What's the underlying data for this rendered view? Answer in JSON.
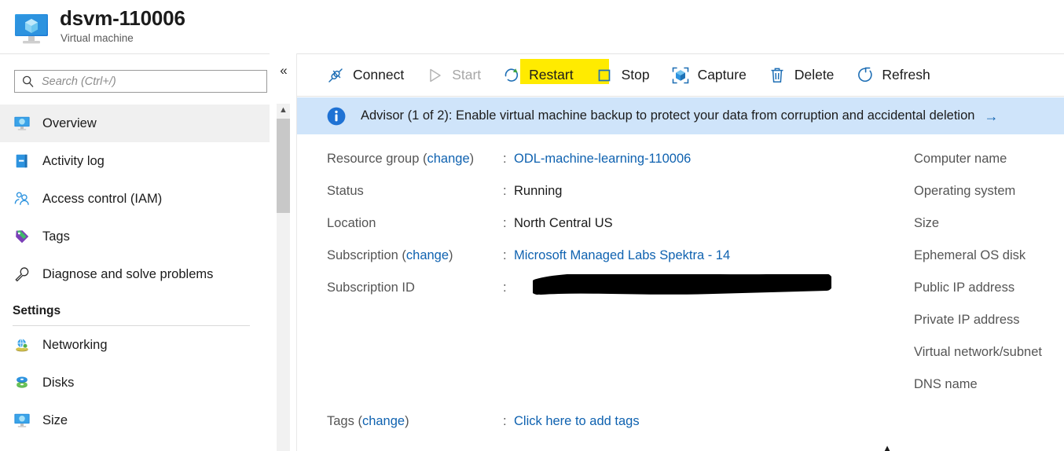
{
  "header": {
    "title": "dsvm-110006",
    "subtitle": "Virtual machine",
    "icon": "virtual-machine-icon"
  },
  "sidebar": {
    "search": {
      "placeholder": "Search (Ctrl+/)",
      "value": "",
      "icon": "search-icon"
    },
    "collapse_icon": "chevron-double-left-icon",
    "items": [
      {
        "label": "Overview",
        "icon": "monitor-icon",
        "selected": true
      },
      {
        "label": "Activity log",
        "icon": "book-icon",
        "selected": false
      },
      {
        "label": "Access control (IAM)",
        "icon": "people-icon",
        "selected": false
      },
      {
        "label": "Tags",
        "icon": "tag-icon",
        "selected": false
      },
      {
        "label": "Diagnose and solve problems",
        "icon": "wrench-icon",
        "selected": false
      }
    ],
    "group": {
      "title": "Settings",
      "items": [
        {
          "label": "Networking",
          "icon": "network-globe-icon",
          "selected": false
        },
        {
          "label": "Disks",
          "icon": "disks-icon",
          "selected": false
        },
        {
          "label": "Size",
          "icon": "monitor-icon",
          "selected": false
        }
      ]
    },
    "scrollbar": {
      "up_icon": "chevron-up-icon"
    }
  },
  "toolbar": {
    "buttons": [
      {
        "label": "Connect",
        "icon": "plug-icon",
        "enabled": true,
        "highlighted": false
      },
      {
        "label": "Start",
        "icon": "play-icon",
        "enabled": false,
        "highlighted": false
      },
      {
        "label": "Restart",
        "icon": "restart-arrow-icon",
        "enabled": true,
        "highlighted": true
      },
      {
        "label": "Stop",
        "icon": "stop-square-icon",
        "enabled": true,
        "highlighted": false
      },
      {
        "label": "Capture",
        "icon": "capture-cube-icon",
        "enabled": true,
        "highlighted": false
      },
      {
        "label": "Delete",
        "icon": "trash-icon",
        "enabled": true,
        "highlighted": false
      },
      {
        "label": "Refresh",
        "icon": "refresh-circle-icon",
        "enabled": true,
        "highlighted": false
      }
    ],
    "highlight_color": "#ffeb00"
  },
  "banner": {
    "icon": "info-icon",
    "text": "Advisor (1 of 2): Enable virtual machine backup to protect your data from corruption and accidental deletion",
    "arrow": "→",
    "background": "#cfe4fa"
  },
  "properties_left": [
    {
      "label": "Resource group",
      "label_link": "change",
      "separator": ":",
      "value": "ODL-machine-learning-110006",
      "value_is_link": true,
      "redacted": false
    },
    {
      "label": "Status",
      "label_link": "",
      "separator": ":",
      "value": "Running",
      "value_is_link": false,
      "redacted": false
    },
    {
      "label": "Location",
      "label_link": "",
      "separator": ":",
      "value": "North Central US",
      "value_is_link": false,
      "redacted": false
    },
    {
      "label": "Subscription",
      "label_link": "change",
      "separator": ":",
      "value": "Microsoft Managed Labs Spektra - 14",
      "value_is_link": true,
      "redacted": false
    },
    {
      "label": "Subscription ID",
      "label_link": "",
      "separator": ":",
      "value": "",
      "value_is_link": false,
      "redacted": true
    }
  ],
  "properties_right": [
    "Computer name",
    "Operating system",
    "Size",
    "Ephemeral OS disk",
    "Public IP address",
    "Private IP address",
    "Virtual network/subnet",
    "DNS name"
  ],
  "tags_row": {
    "label": "Tags",
    "label_link": "change",
    "separator": ":",
    "value": "Click here to add tags"
  },
  "expander_icon": "chevron-up-icon",
  "colors": {
    "link": "#0f62b0",
    "accent": "#0078d4",
    "highlight": "#ffeb00",
    "banner_bg": "#cfe4fa",
    "selected_nav": "#f0f0f0"
  }
}
